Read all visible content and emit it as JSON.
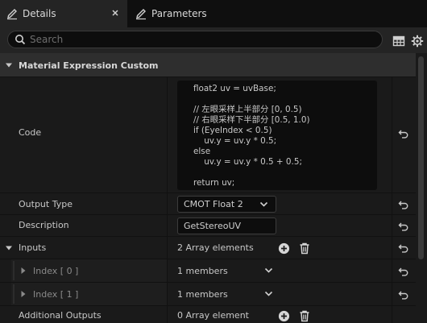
{
  "tabs": [
    {
      "label": "Details",
      "active": true,
      "icon": "pencil-icon"
    },
    {
      "label": "Parameters",
      "active": false,
      "icon": "pencil-icon"
    }
  ],
  "search": {
    "placeholder": "Search",
    "value": ""
  },
  "category": {
    "title": "Material Expression Custom"
  },
  "code": {
    "label": "Code",
    "lines": [
      "float2 uv = uvBase;",
      "",
      "// 左眼采样上半部分 [0, 0.5)",
      "// 右眼采样下半部分 [0.5, 1.0)",
      "if (EyeIndex < 0.5)",
      "    uv.y = uv.y * 0.5;",
      "else",
      "    uv.y = uv.y * 0.5 + 0.5;",
      "",
      "return uv;"
    ]
  },
  "output_type": {
    "label": "Output Type",
    "value": "CMOT Float 2"
  },
  "description": {
    "label": "Description",
    "value": "GetStereoUV"
  },
  "inputs": {
    "label": "Inputs",
    "count_text": "2 Array elements",
    "items": [
      {
        "label": "Index [ 0 ]",
        "value": "1 members"
      },
      {
        "label": "Index [ 1 ]",
        "value": "1 members"
      }
    ]
  },
  "additional_outputs": {
    "label": "Additional Outputs",
    "count_text": "0 Array element"
  },
  "colors": {
    "panel_bg": "#1a1a1a",
    "category_bg": "#2e2e2e",
    "field_bg": "#0d0d0d",
    "text": "#c8c8c8"
  }
}
